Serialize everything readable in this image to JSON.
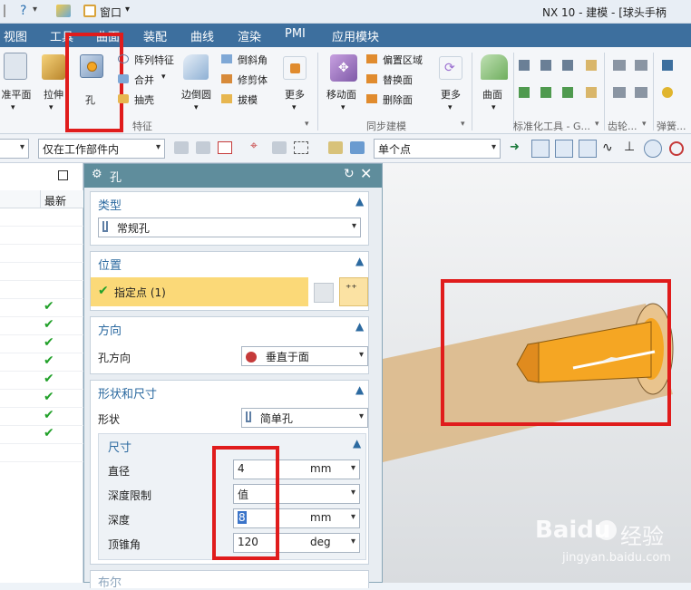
{
  "title_bar": {
    "window_menu": "窗口",
    "title": "NX 10 - 建模 - [球头手柄"
  },
  "menu_tabs": [
    "视图",
    "工具",
    "曲面",
    "装配",
    "曲线",
    "渲染",
    "PMI",
    "应用模块"
  ],
  "ribbon": {
    "left_buttons": [
      "准平面",
      "拉伸",
      "孔"
    ],
    "feature_small": [
      "阵列特征",
      "合并",
      "抽壳"
    ],
    "edge_blend": "边倒圆",
    "feature_small2": [
      "倒斜角",
      "修剪体",
      "拔模"
    ],
    "more1": "更多",
    "feature_group": "特征",
    "move_face": "移动面",
    "sync_small": [
      "偏置区域",
      "替换面",
      "删除面"
    ],
    "more2": "更多",
    "sync_group": "同步建模",
    "surface": "曲面",
    "std_tools_group": "标准化工具 - G...",
    "gear_group": "齿轮...",
    "spring_group": "弹簧..."
  },
  "selection_bar": {
    "filter_value": "仅在工作部件内",
    "point_mode": "单个点"
  },
  "nav_panel": {
    "column_header": "最新",
    "checked_rows": 8
  },
  "dialog": {
    "title": "孔",
    "type_section": "类型",
    "type_value": "常规孔",
    "position_section": "位置",
    "specify_point": "指定点 (1)",
    "direction_section": "方向",
    "hole_direction_label": "孔方向",
    "hole_direction_value": "垂直于面",
    "shape_section": "形状和尺寸",
    "shape_label": "形状",
    "shape_value": "简单孔",
    "dims_section": "尺寸",
    "diameter_label": "直径",
    "diameter_value": "4",
    "diameter_unit": "mm",
    "depth_limit_label": "深度限制",
    "depth_limit_value": "值",
    "depth_label": "深度",
    "depth_value": "8",
    "depth_unit": "mm",
    "tip_angle_label": "顶锥角",
    "tip_angle_value": "120",
    "tip_angle_unit": "deg",
    "next_section": "布尔"
  },
  "watermark": {
    "brand": "Baidu",
    "sub": "经验",
    "url": "jingyan.baidu.com"
  },
  "colors": {
    "menubar": "#3d6f9e",
    "dialog_title": "#5f8d9c",
    "highlight": "#fbd978",
    "annotation_red": "#e01c1c",
    "model_orange": "#f5a623"
  }
}
